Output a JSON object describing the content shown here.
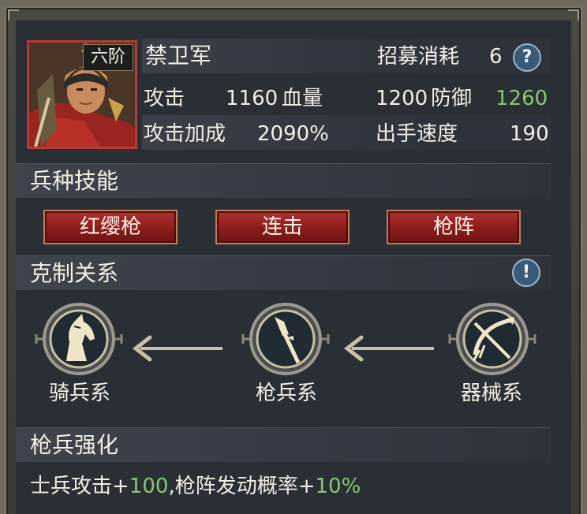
{
  "unit": {
    "name": "禁卫军",
    "rank": "六阶",
    "recruit_cost_label": "招募消耗",
    "recruit_cost_value": "6"
  },
  "stats": {
    "attack_label": "攻击",
    "attack_value": "1160",
    "hp_label": "血量",
    "hp_value": "1200",
    "defense_label": "防御",
    "defense_value": "1260",
    "attack_bonus_label": "攻击加成",
    "attack_bonus_value": "2090%",
    "speed_label": "出手速度",
    "speed_value": "190"
  },
  "skills": {
    "title": "兵种技能",
    "items": [
      "红缨枪",
      "连击",
      "枪阵"
    ]
  },
  "counter": {
    "title": "克制关系",
    "info_icon": "!",
    "units": [
      {
        "label": "骑兵系",
        "icon": "horse-head-icon"
      },
      {
        "label": "枪兵系",
        "icon": "spear-icon"
      },
      {
        "label": "器械系",
        "icon": "crossbow-icon"
      }
    ]
  },
  "enhance": {
    "title": "枪兵强化",
    "prefix": "士兵攻击+",
    "value1": "100",
    "middle": ",枪阵发动概率+",
    "value2": "10%"
  },
  "help_icon": "?",
  "colors": {
    "accent_green": "#8ac76a",
    "button_red": "#9a2320",
    "panel_bg": "#2a2e35"
  }
}
